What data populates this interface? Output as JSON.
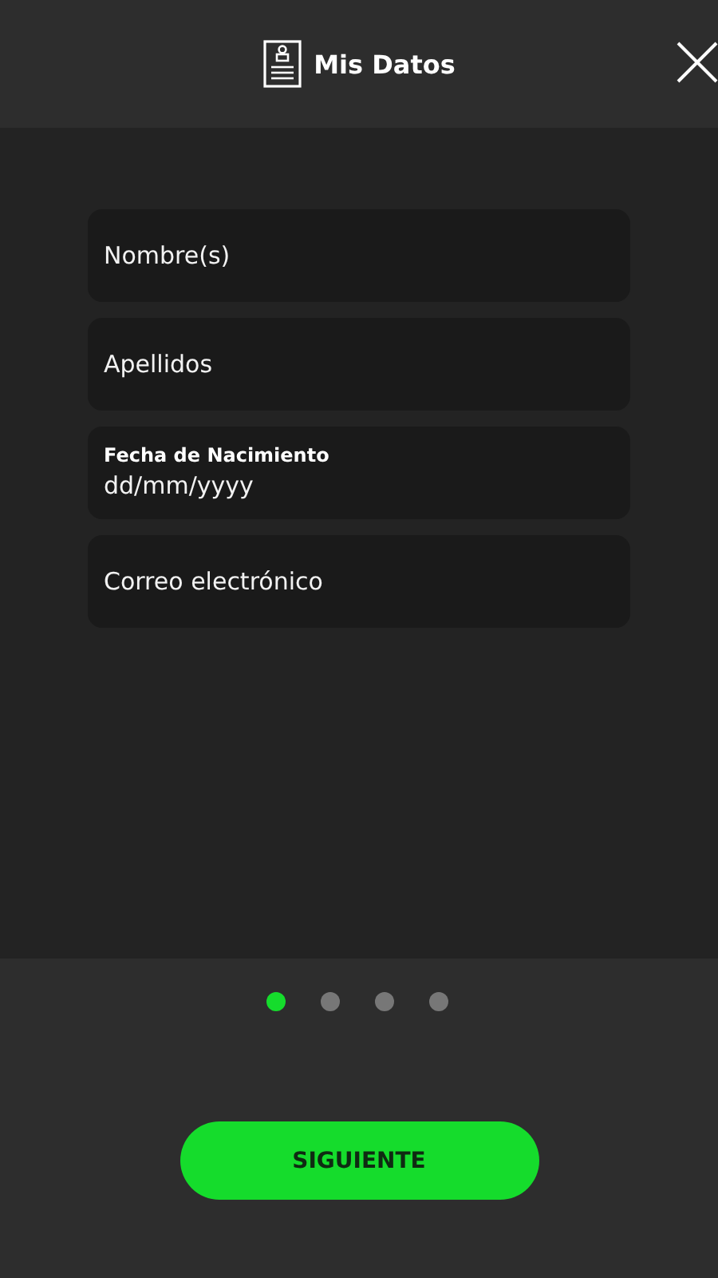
{
  "header": {
    "title": "Mis Datos"
  },
  "fields": [
    {
      "kind": "text",
      "placeholder": "Nombre(s)"
    },
    {
      "kind": "text",
      "placeholder": "Apellidos"
    },
    {
      "kind": "date",
      "label": "Fecha de Nacimiento",
      "placeholder": "dd/mm/yyyy"
    },
    {
      "kind": "text",
      "placeholder": "Correo electrónico"
    }
  ],
  "pager": [
    {
      "selected": true
    },
    {
      "selected": false
    },
    {
      "selected": false
    },
    {
      "selected": false
    }
  ],
  "button": "SIGUIENTE"
}
